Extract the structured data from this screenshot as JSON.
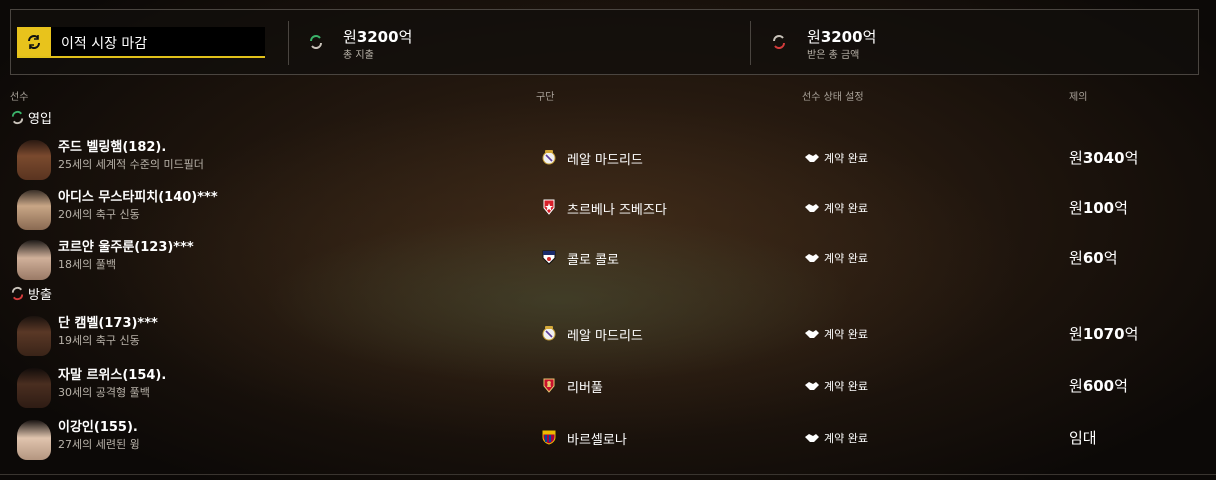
{
  "summary": {
    "deadline_label": "이적 시장 마감",
    "spent": {
      "currency": "원",
      "amount": "3200",
      "unit": "억",
      "label": "총 지출"
    },
    "received": {
      "currency": "원",
      "amount": "3200",
      "unit": "억",
      "label": "받은 총 금액"
    }
  },
  "columns": {
    "player": "선수",
    "club": "구단",
    "status": "선수 상태 설정",
    "offer": "제의"
  },
  "sections": {
    "incoming": "영입",
    "outgoing": "방출"
  },
  "incoming": [
    {
      "name": "주드 벨링햄(182).",
      "desc": "25세의 세계적 수준의 미드필더",
      "club": "레알 마드리드",
      "crest": "real-madrid-crest-icon",
      "status": "계약 완료",
      "offer_prefix": "원",
      "offer_amount": "3040",
      "offer_unit": "억"
    },
    {
      "name": "아디스 무스타피치(140)***",
      "desc": "20세의 축구 신동",
      "club": "츠르베나 즈베즈다",
      "crest": "red-star-crest-icon",
      "status": "계약 완료",
      "offer_prefix": "원",
      "offer_amount": "100",
      "offer_unit": "억"
    },
    {
      "name": "코르얀 울주룬(123)***",
      "desc": "18세의 풀백",
      "club": "콜로 콜로",
      "crest": "colo-colo-crest-icon",
      "status": "계약 완료",
      "offer_prefix": "원",
      "offer_amount": "60",
      "offer_unit": "억"
    }
  ],
  "outgoing": [
    {
      "name": "단 캠벨(173)***",
      "desc": "19세의 축구 신동",
      "club": "레알 마드리드",
      "crest": "real-madrid-crest-icon",
      "status": "계약 완료",
      "offer_prefix": "원",
      "offer_amount": "1070",
      "offer_unit": "억"
    },
    {
      "name": "자말 르위스(154).",
      "desc": "30세의 공격형 풀백",
      "club": "리버풀",
      "crest": "liverpool-crest-icon",
      "status": "계약 완료",
      "offer_prefix": "원",
      "offer_amount": "600",
      "offer_unit": "억"
    },
    {
      "name": "이강인(155).",
      "desc": "27세의 세련된 윙",
      "club": "바르셀로나",
      "crest": "barcelona-crest-icon",
      "status": "계약 완료",
      "offer_prefix": "",
      "offer_amount": "",
      "offer_unit": "",
      "offer_text": "임대"
    }
  ],
  "colors": {
    "accent": "#e8c31c",
    "incoming_arrow": "#3bb36a",
    "outgoing_arrow": "#d43c3c"
  }
}
